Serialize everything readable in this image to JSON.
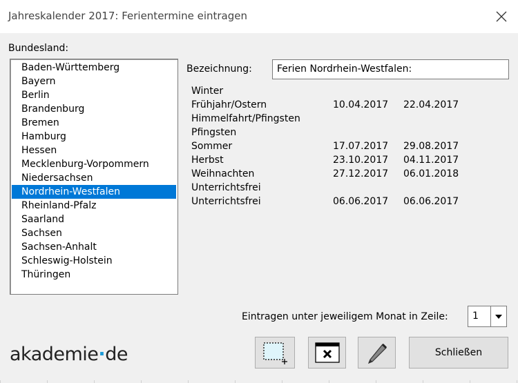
{
  "window": {
    "title": "Jahreskalender 2017: Ferientermine eintragen",
    "close_glyph": "✕"
  },
  "bundesland": {
    "label": "Bundesland:",
    "items": [
      "Baden-Württemberg",
      "Bayern",
      "Berlin",
      "Brandenburg",
      "Bremen",
      "Hamburg",
      "Hessen",
      "Mecklenburg-Vorpommern",
      "Niedersachsen",
      "Nordrhein-Westfalen",
      "Rheinland-Pfalz",
      "Saarland",
      "Sachsen",
      "Sachsen-Anhalt",
      "Schleswig-Holstein",
      "Thüringen"
    ],
    "selected": "Nordrhein-Westfalen"
  },
  "bezeichnung": {
    "label": "Bezeichnung:",
    "value": "Ferien Nordrhein-Westfalen:"
  },
  "terms": [
    {
      "name": "Winter",
      "from": "",
      "to": ""
    },
    {
      "name": "Frühjahr/Ostern",
      "from": "10.04.2017",
      "to": "22.04.2017"
    },
    {
      "name": "Himmelfahrt/Pfingsten",
      "from": "",
      "to": ""
    },
    {
      "name": "Pfingsten",
      "from": "",
      "to": ""
    },
    {
      "name": "Sommer",
      "from": "17.07.2017",
      "to": "29.08.2017"
    },
    {
      "name": "Herbst",
      "from": "23.10.2017",
      "to": "04.11.2017"
    },
    {
      "name": "Weihnachten",
      "from": "27.12.2017",
      "to": "06.01.2018"
    },
    {
      "name": "Unterrichtsfrei",
      "from": "",
      "to": ""
    },
    {
      "name": "Unterrichtsfrei",
      "from": "06.06.2017",
      "to": "06.06.2017"
    }
  ],
  "row_select": {
    "label": "Eintragen unter jeweiligem Monat in Zeile:",
    "value": "1"
  },
  "logo": {
    "part1": "akademie",
    "dot": "·",
    "part2": "de",
    "dot_color": "#1c9ad6"
  },
  "buttons": {
    "add_icon": "select-add-icon",
    "delete_icon": "window-delete-icon",
    "edit_icon": "pencil-icon",
    "close_label": "Schließen"
  },
  "colors": {
    "selection": "#0078d7",
    "dialog_background": "#f0f0f0"
  }
}
